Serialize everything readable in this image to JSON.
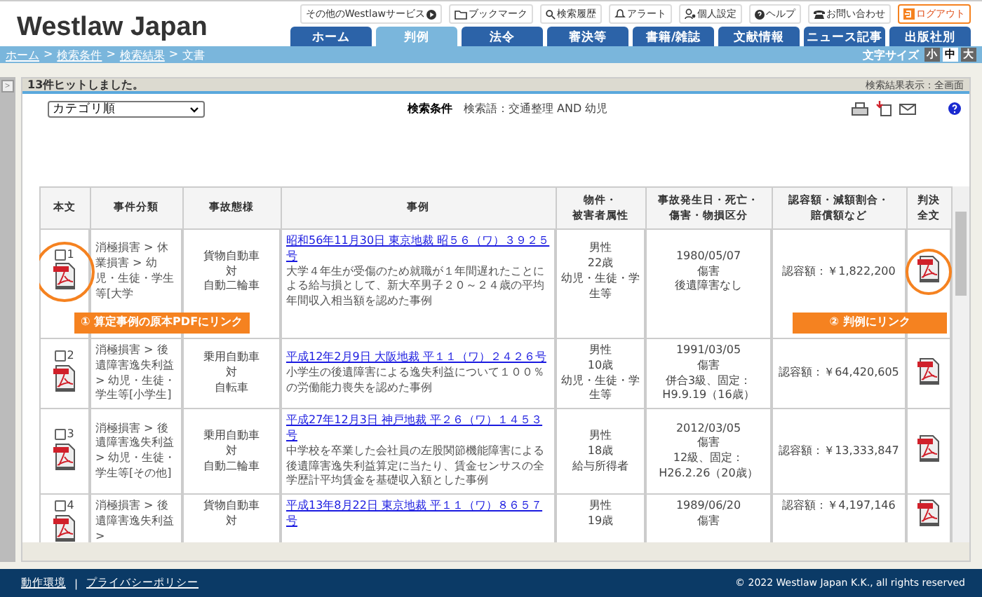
{
  "header": {
    "logo": "Westlaw Japan",
    "top_links": [
      {
        "label": "その他のWestlawサービス",
        "kind": "services"
      },
      {
        "label": "ブックマーク",
        "kind": "bookmark"
      },
      {
        "label": "検索履歴",
        "kind": "history"
      },
      {
        "label": "アラート",
        "kind": "alert"
      },
      {
        "label": "個人設定",
        "kind": "settings"
      },
      {
        "label": "ヘルプ",
        "kind": "help"
      },
      {
        "label": "お問い合わせ",
        "kind": "contact"
      },
      {
        "label": "ログアウト",
        "kind": "logout"
      }
    ],
    "tabs": [
      {
        "label": "ホーム",
        "selected": false
      },
      {
        "label": "判例",
        "selected": true
      },
      {
        "label": "法令",
        "selected": false
      },
      {
        "label": "審決等",
        "selected": false
      },
      {
        "label": "書籍/雑誌",
        "selected": false
      },
      {
        "label": "文献情報",
        "selected": false
      },
      {
        "label": "ニュース記事",
        "selected": false
      },
      {
        "label": "出版社別",
        "selected": false
      }
    ]
  },
  "breadcrumb": {
    "separator": ">",
    "items": [
      {
        "label": "ホーム",
        "link": true
      },
      {
        "label": "検索条件",
        "link": true
      },
      {
        "label": "検索結果",
        "link": true
      },
      {
        "label": "文書",
        "link": false
      }
    ]
  },
  "font_size": {
    "label": "文字サイズ",
    "options": [
      {
        "label": "小",
        "selected": false
      },
      {
        "label": "中",
        "selected": true
      },
      {
        "label": "大",
        "selected": false
      }
    ]
  },
  "sidebar_toggle": ">",
  "results": {
    "hit_count": "13件ヒットしました。",
    "display_mode": "検索結果表示：全画面",
    "sort": "カテゴリ順",
    "condition_label": "検索条件",
    "condition": "検索語：交通整理 AND 幼児",
    "columns": [
      [
        "本文"
      ],
      [
        "事件分類"
      ],
      [
        "事故態様"
      ],
      [
        "事例"
      ],
      [
        "物件・",
        "被害者属性"
      ],
      [
        "事故発生日・死亡・",
        "傷害・物損区分"
      ],
      [
        "認容額・減額割合・",
        "賠償額など"
      ],
      [
        "判決",
        "全文"
      ]
    ],
    "rows": [
      {
        "no": "1",
        "checked": false,
        "category": "消極損害 > 休業損害 > 幼児・生徒・学生等[大学",
        "accident": [
          "貨物自動車",
          "対",
          "自動二輪車"
        ],
        "case_link": "昭和56年11月30日 東京地裁 昭５６（ワ）３９２５号",
        "summary": "大学４年生が受傷のため就職が１年間遅れたことによる給与損として、新大卒男子２０～２４歳の平均年間収入相当額を認めた事例",
        "victim": [
          "男性",
          "22歳",
          "幼児・生徒・学生等"
        ],
        "incident": [
          "1980/05/07",
          "傷害",
          "後遺障害なし"
        ],
        "award": "認容額：￥1,822,200"
      },
      {
        "no": "2",
        "checked": false,
        "category": "消極損害 > 後遺障害逸失利益 > 幼児・生徒・学生等[小学生]",
        "accident": [
          "乗用自動車",
          "対",
          "自転車"
        ],
        "case_link": "平成12年2月9日 大阪地裁 平１１（ワ）２４２６号",
        "summary": "小学生の後遺障害による逸失利益について１００％の労働能力喪失を認めた事例",
        "victim": [
          "男性",
          "10歳",
          "幼児・生徒・学生等"
        ],
        "incident": [
          "1991/03/05",
          "傷害",
          "併合3級、固定：H9.9.19（16歳）"
        ],
        "award": "認容額：￥64,420,605"
      },
      {
        "no": "3",
        "checked": false,
        "category": "消極損害 > 後遺障害逸失利益 > 幼児・生徒・学生等[その他]",
        "accident": [
          "乗用自動車",
          "対",
          "自動二輪車"
        ],
        "case_link": "平成27年12月3日 神戸地裁 平２６（ワ）１４５３号",
        "summary": "中学校を卒業した会社員の左股関節機能障害による後遺障害逸失利益算定に当たり、賃金センサスの全学歴計平均賃金を基礎収入額とした事例",
        "victim": [
          "男性",
          "18歳",
          "給与所得者"
        ],
        "incident": [
          "2012/03/05",
          "傷害",
          "12級、固定：H26.2.26（20歳）"
        ],
        "award": "認容額：￥13,333,847"
      },
      {
        "no": "4",
        "checked": false,
        "category": "消極損害 > 後遺障害逸失利益 >",
        "accident": [
          "貨物自動車",
          "対"
        ],
        "case_link": "平成13年8月22日 東京地裁 平１１（ワ）８６５７号",
        "victim": [
          "男性",
          "19歳"
        ],
        "incident": [
          "1989/06/20",
          "傷害"
        ],
        "award": "認容額：￥4,197,146"
      }
    ]
  },
  "callouts": [
    {
      "text": "① 算定事例の原本PDFにリンク"
    },
    {
      "text": "② 判例にリンク"
    }
  ],
  "footer": {
    "links": [
      "動作環境",
      "プライバシーポリシー"
    ],
    "separator": "|",
    "copyright": "© 2022 Westlaw Japan K.K., all rights reserved"
  }
}
